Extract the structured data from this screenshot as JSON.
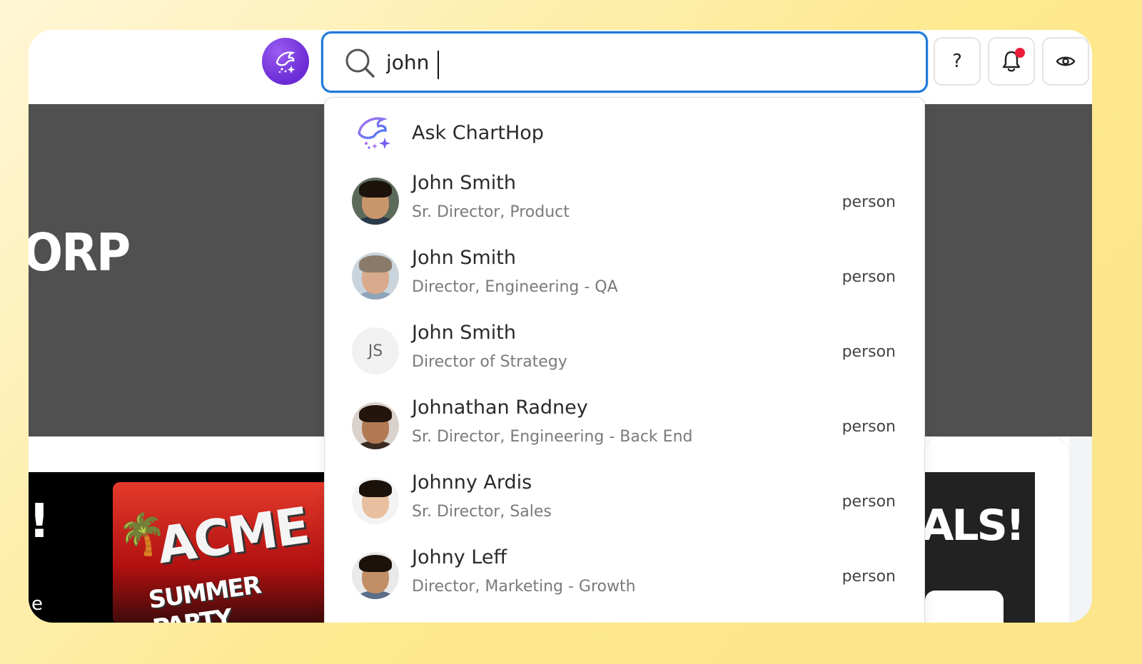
{
  "topbar": {
    "search_value": "john",
    "help_label": "?"
  },
  "background": {
    "hero_text": "ORP",
    "left_card_text": "!",
    "left_card_small": "e",
    "poster_title": "ACME",
    "poster_subtitle": "SUMMER PARTY",
    "right_card_text": "ALS!"
  },
  "dropdown": {
    "ask_label": "Ask ChartHop",
    "results": [
      {
        "name": "John Smith",
        "title": "Sr. Director, Product",
        "type": "person",
        "avatar": "photo",
        "skin": "#c9966c",
        "hair": "#1b120c",
        "shirt": "#2b3a4a",
        "bg": "#5c6a5a"
      },
      {
        "name": "John Smith",
        "title": "Director, Engineering - QA",
        "type": "person",
        "avatar": "photo",
        "skin": "#d8a98a",
        "hair": "#8a7a6a",
        "shirt": "#8fa4b8",
        "bg": "#c9d4dc"
      },
      {
        "name": "John Smith",
        "title": "Director of Strategy",
        "type": "person",
        "avatar": "initials",
        "initials": "JS"
      },
      {
        "name": "Johnathan Radney",
        "title": "Sr. Director, Engineering - Back End",
        "type": "person",
        "avatar": "photo",
        "skin": "#b27a54",
        "hair": "#24150c",
        "shirt": "#3a2a22",
        "bg": "#d9d2cc"
      },
      {
        "name": "Johnny Ardis",
        "title": "Sr. Director, Sales",
        "type": "person",
        "avatar": "photo",
        "skin": "#e8c0a0",
        "hair": "#1b120c",
        "shirt": "#f3f3f3",
        "bg": "#f3f3f3"
      },
      {
        "name": "Johny Leff",
        "title": "Director, Marketing - Growth",
        "type": "person",
        "avatar": "photo",
        "skin": "#c28e66",
        "hair": "#1b120c",
        "shirt": "#5b6e8a",
        "bg": "#e9e9e9"
      }
    ]
  },
  "colors": {
    "accent": "#1f7ad8",
    "logo_purple": "#6a2bd6",
    "notification_red": "#ec1c3a"
  }
}
